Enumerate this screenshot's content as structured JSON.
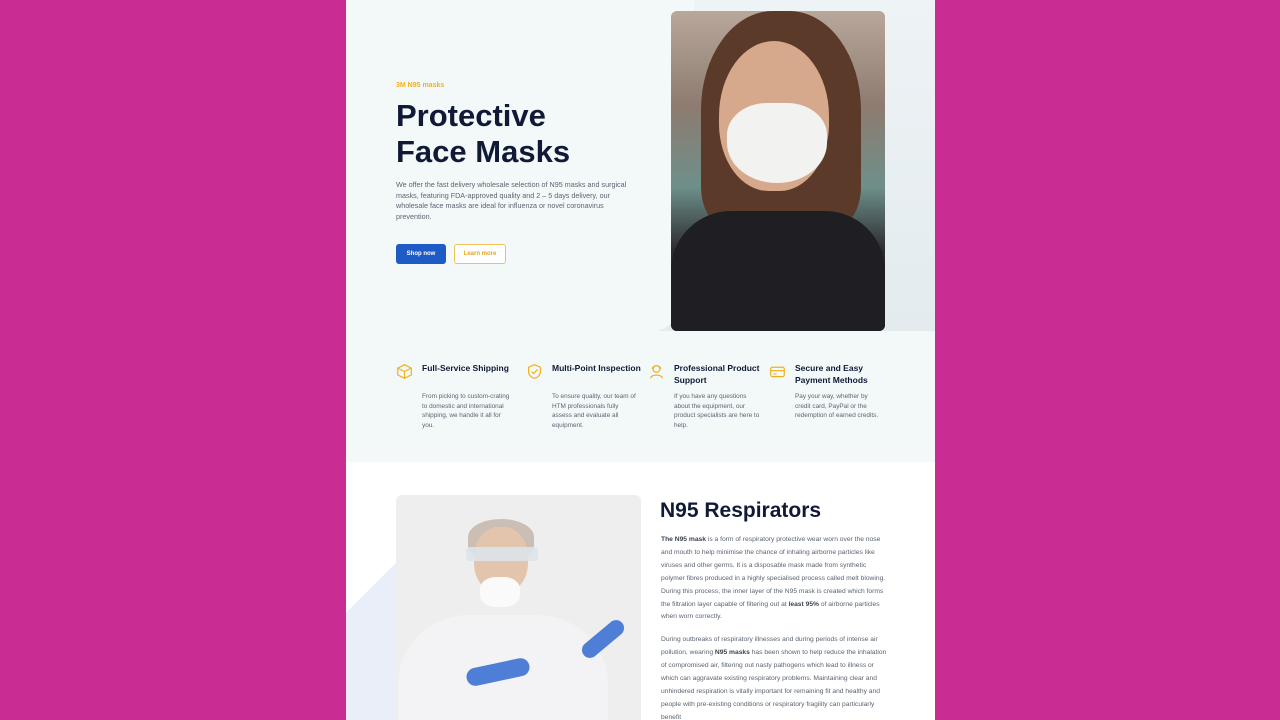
{
  "hero": {
    "eyebrow": "3M N95 masks",
    "title_line1": "Protective",
    "title_line2": "Face Masks",
    "lead": "We offer the fast delivery wholesale selection of N95 masks and surgical masks, featuring FDA-approved quality and 2 – 5 days delivery, our wholesale face masks are ideal for influenza or novel coronavirus prevention.",
    "primary_label": "Shop now",
    "secondary_label": "Learn more"
  },
  "features": [
    {
      "icon": "box-icon",
      "title": "Full-Service Shipping",
      "text": "From picking to custom-crating to domestic and international shipping, we handle it all for you."
    },
    {
      "icon": "shield-check-icon",
      "title": "Multi-Point Inspection",
      "text": "To ensure quality, our team of HTM professionals fully assess and evaluate all equipment."
    },
    {
      "icon": "support-agent-icon",
      "title": "Professional Product Support",
      "text": "If you have any questions about the equipment, our product specialists are here to help."
    },
    {
      "icon": "credit-card-icon",
      "title": "Secure and Easy Payment Methods",
      "text": "Pay your way, whether by credit card, PayPal or the redemption of earned credits."
    }
  ],
  "n95": {
    "heading": "N95 Respirators",
    "p1_lead": "The N95 mask",
    "p1_mid": " is a form of respiratory protective wear worn over the nose and mouth to help minimise the chance of inhaling airborne particles like viruses and other germs. It is a disposable mask made from synthetic polymer fibres produced in a highly specialised process called melt blowing. During this process, the inner layer of the N95 mask is created which forms the filtration layer capable of filtering out at ",
    "p1_bold": "least 95%",
    "p1_end": " of airborne particles when worn correctly.",
    "p2_start": "During outbreaks of respiratory illnesses and during periods of intense air pollution, wearing ",
    "p2_bold": "N95 masks",
    "p2_end": " has been shown to help reduce the inhalation of compromised air, filtering out nasty pathogens which lead to illness or which can aggravate existing respiratory problems. Maintaining clear and unhindered respiration is vitally important for remaining fit and healthy and people with pre-existing conditions or respiratory fragility can particularly benefit"
  },
  "colors": {
    "background": "#c92c93",
    "accent_blue": "#1f5bc6",
    "accent_gold": "#f2b01e",
    "heading": "#101a36"
  }
}
